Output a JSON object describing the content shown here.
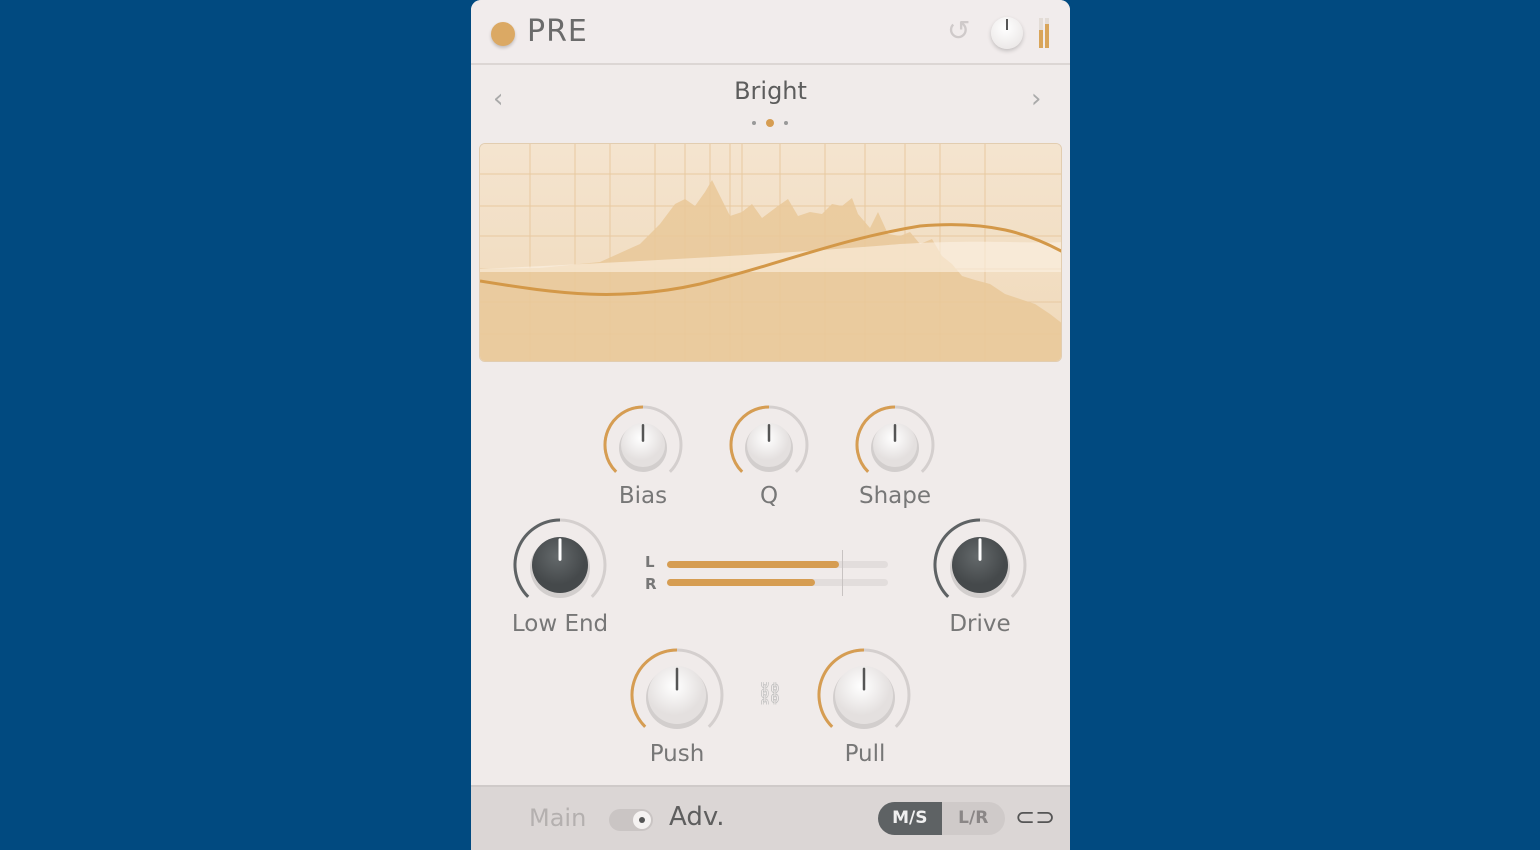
{
  "header": {
    "title": "PRE",
    "power_on": true,
    "undo_icon": "undo-icon",
    "output_gain": 0.5
  },
  "preset": {
    "name": "Bright",
    "prev_icon": "‹",
    "next_icon": "›",
    "page_count": 3,
    "current_page": 2
  },
  "colors": {
    "accent": "#d69d52",
    "background": "#014a80",
    "panel": "#f0ebea",
    "dark_knob": "#555a5c"
  },
  "knobs": {
    "bias": {
      "label": "Bias",
      "value": 0.5
    },
    "q": {
      "label": "Q",
      "value": 0.5
    },
    "shape": {
      "label": "Shape",
      "value": 0.5
    },
    "low_end": {
      "label": "Low End",
      "value": 0.5
    },
    "drive": {
      "label": "Drive",
      "value": 0.5
    },
    "push": {
      "label": "Push",
      "value": 0.5
    },
    "pull": {
      "label": "Pull",
      "value": 0.5
    }
  },
  "meter": {
    "l_label": "L",
    "r_label": "R",
    "l_level": 0.78,
    "r_level": 0.67,
    "marker": 0.79
  },
  "footer": {
    "main_label": "Main",
    "adv_label": "Adv.",
    "mode_selected": "M/S",
    "ms_label": "M/S",
    "lr_label": "L/R",
    "link_icon": "link-icon"
  }
}
